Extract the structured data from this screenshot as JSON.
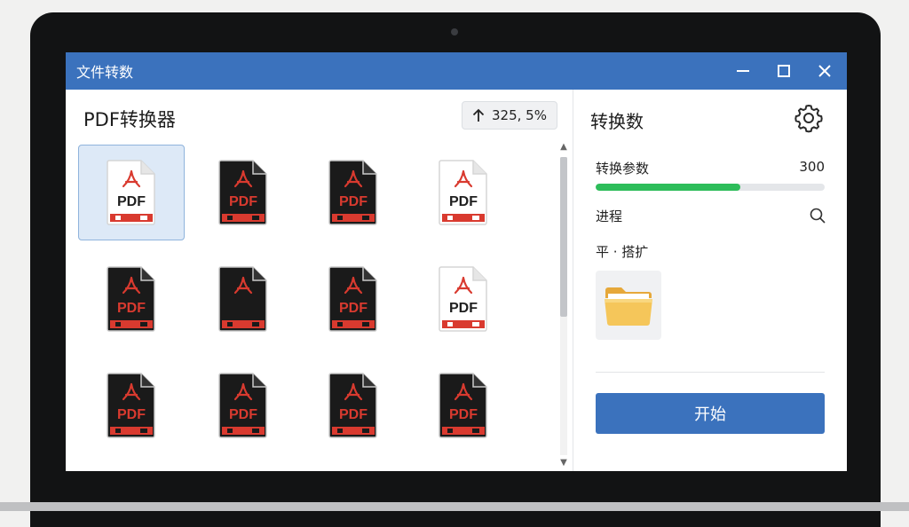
{
  "window": {
    "title": "文件转数"
  },
  "left": {
    "title": "PDF转换器",
    "stat": "325, 5%",
    "files": [
      {
        "label": "PDF",
        "style": "light",
        "state": "selected"
      },
      {
        "label": "PDF",
        "style": "dark",
        "state": "normal"
      },
      {
        "label": "PDF",
        "style": "dark",
        "state": "normal"
      },
      {
        "label": "PDF",
        "style": "light",
        "state": "normal"
      },
      {
        "label": "PDF",
        "style": "dark",
        "state": "normal"
      },
      {
        "label": "",
        "style": "dark",
        "state": "normal"
      },
      {
        "label": "PDF",
        "style": "dark",
        "state": "normal"
      },
      {
        "label": "PDF",
        "style": "light",
        "state": "normal"
      },
      {
        "label": "PDF",
        "style": "dark",
        "state": "normal"
      },
      {
        "label": "PDF",
        "style": "dark",
        "state": "normal"
      },
      {
        "label": "PDF",
        "style": "dark",
        "state": "normal"
      },
      {
        "label": "PDF",
        "style": "dark",
        "state": "normal"
      }
    ]
  },
  "right": {
    "title": "转换数",
    "param_label": "转换参数",
    "param_value": "300",
    "param_progress": 0.63,
    "progress_label": "进程",
    "sub_label": "平 · 搭扩",
    "start_label": "开始"
  },
  "colors": {
    "accent": "#3b72bd",
    "progress": "#2dbd5a",
    "pdf_red": "#d93a2f"
  },
  "icons": {
    "settings": "gear-icon",
    "search": "search-icon",
    "folder": "folder-icon",
    "stat": "arrow-up-icon"
  }
}
